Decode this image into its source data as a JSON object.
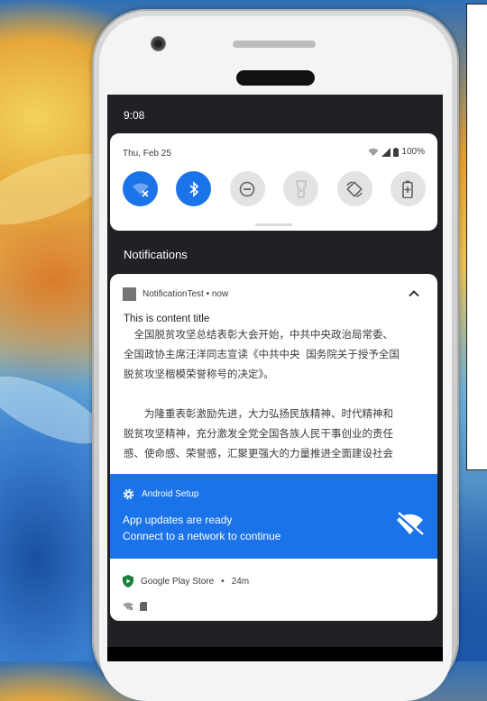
{
  "status_bar": {
    "time": "9:08"
  },
  "quick_settings": {
    "date": "Thu, Feb 25",
    "battery": "100%",
    "tiles": [
      {
        "name": "wifi",
        "state": "on"
      },
      {
        "name": "bluetooth",
        "state": "on"
      },
      {
        "name": "do-not-disturb",
        "state": "off"
      },
      {
        "name": "flashlight",
        "state": "disabled"
      },
      {
        "name": "auto-rotate",
        "state": "off"
      },
      {
        "name": "battery-saver",
        "state": "off"
      }
    ]
  },
  "notifications_header": "Notifications",
  "notification_test": {
    "app": "NotificationTest",
    "time": "now",
    "title": "This is content title",
    "body": "　全国脱贫攻坚总结表彰大会开始，中共中央政治局常委、\n全国政协主席汪洋同志宣读《中共中央 国务院关于授予全国\n脱贫攻坚楷模荣誉称号的决定》。\n\n　　为隆重表彰激励先进，大力弘扬民族精神、时代精神和\n脱贫攻坚精神，充分激发全党全国各族人民干事创业的责任\n感、使命感、荣誉感，汇聚更强大的力量推进全面建设社会"
  },
  "android_setup": {
    "app": "Android Setup",
    "line1": "App updates are ready",
    "line2": "Connect to a network to continue"
  },
  "play_store": {
    "app": "Google Play Store",
    "time": "24m"
  },
  "colors": {
    "accent": "#1a73e8",
    "shade": "#202124"
  }
}
